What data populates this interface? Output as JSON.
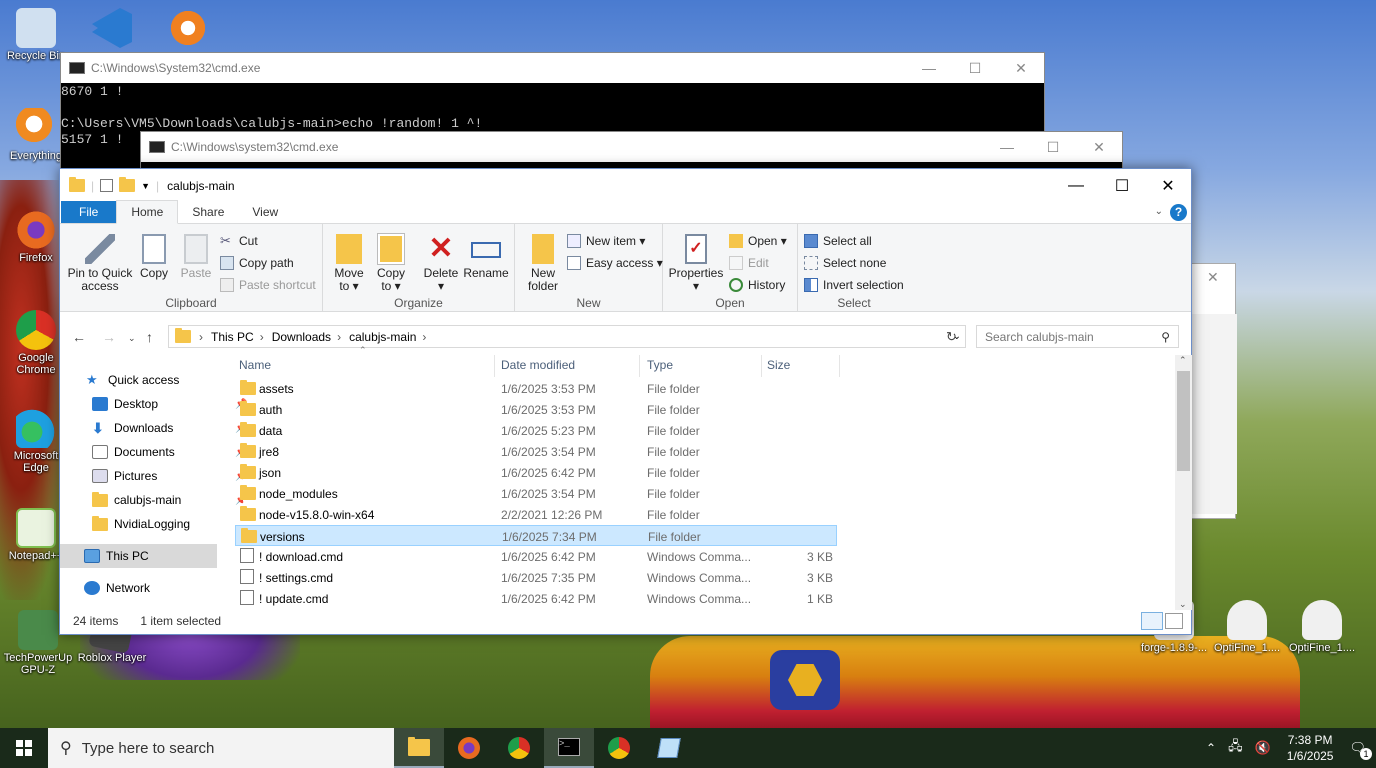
{
  "desktop_icons": [
    {
      "label": "Recycle Bin",
      "color": "#d0e0f0"
    },
    {
      "label": "",
      "color": "#2a7ad0"
    },
    {
      "label": "",
      "color": "#f08020"
    },
    {
      "label": "Everything",
      "color": "#f08a20"
    },
    {
      "label": "Firefox",
      "color": "#e86a20"
    },
    {
      "label": "Google Chrome",
      "color": "#e0c020"
    },
    {
      "label": "Microsoft Edge",
      "color": "#1ea0e0"
    },
    {
      "label": "Notepad++",
      "color": "#80c050"
    },
    {
      "label": "TechPowerUp GPU-Z",
      "color": "#4a8a4a"
    },
    {
      "label": "Roblox Player",
      "color": "#444"
    },
    {
      "label": "forge-1.8.9-...",
      "color": "#e0e0e0"
    },
    {
      "label": "OptiFine_1....",
      "color": "#e0e0e0"
    },
    {
      "label": "OptiFine_1....",
      "color": "#e0e0e0"
    }
  ],
  "cmd1": {
    "title": "C:\\Windows\\System32\\cmd.exe",
    "lines": [
      "8670 1 !",
      "",
      "C:\\Users\\VM5\\Downloads\\calubjs-main>echo !random! 1 ^!",
      "5157 1 !"
    ]
  },
  "cmd2": {
    "title": "C:\\Windows\\system32\\cmd.exe",
    "lines": [
      "                                    "
    ]
  },
  "explorer": {
    "title": "calubjs-main",
    "tabs": [
      "File",
      "Home",
      "Share",
      "View"
    ],
    "ribbon": {
      "clipboard": {
        "label": "Clipboard",
        "pin": "Pin to Quick\naccess",
        "copy": "Copy",
        "paste": "Paste",
        "cut": "Cut",
        "copy_path": "Copy path",
        "paste_shortcut": "Paste shortcut"
      },
      "organize": {
        "label": "Organize",
        "move_to": "Move\nto ▾",
        "copy_to": "Copy\nto ▾",
        "delete": "Delete\n▾",
        "rename": "Rename"
      },
      "new": {
        "label": "New",
        "new_folder": "New\nfolder",
        "new_item": "New item ▾",
        "easy_access": "Easy access ▾"
      },
      "open": {
        "label": "Open",
        "properties": "Properties\n▾",
        "open": "Open ▾",
        "edit": "Edit",
        "history": "History"
      },
      "select": {
        "label": "Select",
        "select_all": "Select all",
        "select_none": "Select none",
        "invert": "Invert selection"
      }
    },
    "address": {
      "crumbs": [
        "This PC",
        "Downloads",
        "calubjs-main"
      ]
    },
    "search_placeholder": "Search calubjs-main",
    "nav": {
      "quick_access": "Quick access",
      "items": [
        "Desktop",
        "Downloads",
        "Documents",
        "Pictures",
        "calubjs-main",
        "NvidiaLogging"
      ],
      "this_pc": "This PC",
      "network": "Network"
    },
    "columns": [
      "Name",
      "Date modified",
      "Type",
      "Size"
    ],
    "files": [
      {
        "name": "assets",
        "date": "1/6/2025 3:53 PM",
        "type": "File folder",
        "size": "",
        "kind": "folder"
      },
      {
        "name": "auth",
        "date": "1/6/2025 3:53 PM",
        "type": "File folder",
        "size": "",
        "kind": "folder"
      },
      {
        "name": "data",
        "date": "1/6/2025 5:23 PM",
        "type": "File folder",
        "size": "",
        "kind": "folder"
      },
      {
        "name": "jre8",
        "date": "1/6/2025 3:54 PM",
        "type": "File folder",
        "size": "",
        "kind": "folder"
      },
      {
        "name": "json",
        "date": "1/6/2025 6:42 PM",
        "type": "File folder",
        "size": "",
        "kind": "folder"
      },
      {
        "name": "node_modules",
        "date": "1/6/2025 3:54 PM",
        "type": "File folder",
        "size": "",
        "kind": "folder"
      },
      {
        "name": "node-v15.8.0-win-x64",
        "date": "2/2/2021 12:26 PM",
        "type": "File folder",
        "size": "",
        "kind": "folder"
      },
      {
        "name": "versions",
        "date": "1/6/2025 7:34 PM",
        "type": "File folder",
        "size": "",
        "kind": "folder"
      },
      {
        "name": "! download.cmd",
        "date": "1/6/2025 6:42 PM",
        "type": "Windows Comma...",
        "size": "3 KB",
        "kind": "cmd"
      },
      {
        "name": "! settings.cmd",
        "date": "1/6/2025 7:35 PM",
        "type": "Windows Comma...",
        "size": "3 KB",
        "kind": "cmd"
      },
      {
        "name": "! update.cmd",
        "date": "1/6/2025 6:42 PM",
        "type": "Windows Comma...",
        "size": "1 KB",
        "kind": "cmd"
      }
    ],
    "status": {
      "count": "24 items",
      "selected": "1 item selected"
    }
  },
  "taskbar": {
    "search_placeholder": "Type here to search",
    "time": "7:38 PM",
    "date": "1/6/2025",
    "notification_count": "1"
  }
}
